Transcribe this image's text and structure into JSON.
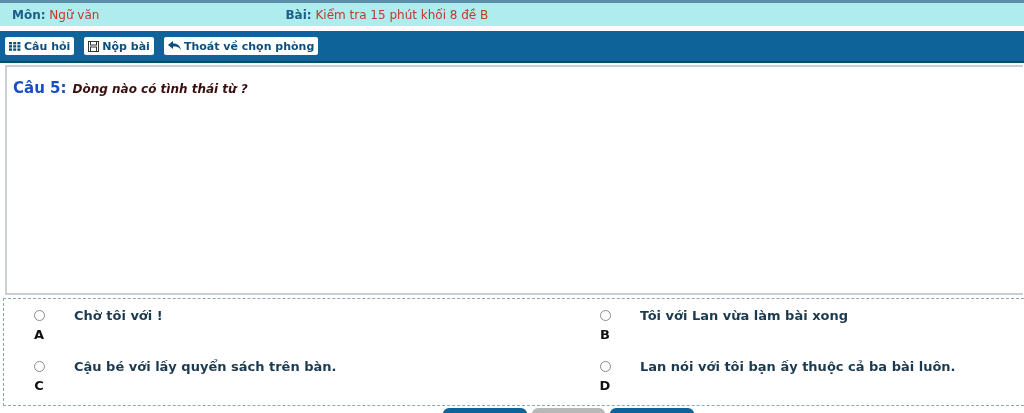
{
  "header": {
    "subject_label": "Môn:",
    "subject": "Ngữ văn",
    "test_label": "Bài:",
    "test": "Kiểm tra 15 phút khối 8 đề B"
  },
  "toolbar": [
    {
      "kind": "grid",
      "label": "Câu hỏi"
    },
    {
      "kind": "save",
      "label": "Nộp bài"
    },
    {
      "kind": "back",
      "label": "Thoát về chọn phòng"
    }
  ],
  "question": {
    "number": "Câu 5:",
    "text": "Dòng nào có tình thái từ ?"
  },
  "options": [
    {
      "letter": "A",
      "text": "Chờ tôi với !",
      "selected": false
    },
    {
      "letter": "B",
      "text": "Tôi với Lan vừa làm bài xong",
      "selected": false
    },
    {
      "letter": "C",
      "text": "Cậu bé với lấy quyển sách trên bàn.",
      "selected": false
    },
    {
      "letter": "D",
      "text": "Lan nói với tôi bạn ấy thuộc cả ba bài luôn.",
      "selected": false
    }
  ],
  "bottom_buttons": [
    {
      "disabled": false
    },
    {
      "disabled": true
    },
    {
      "disabled": false
    }
  ]
}
